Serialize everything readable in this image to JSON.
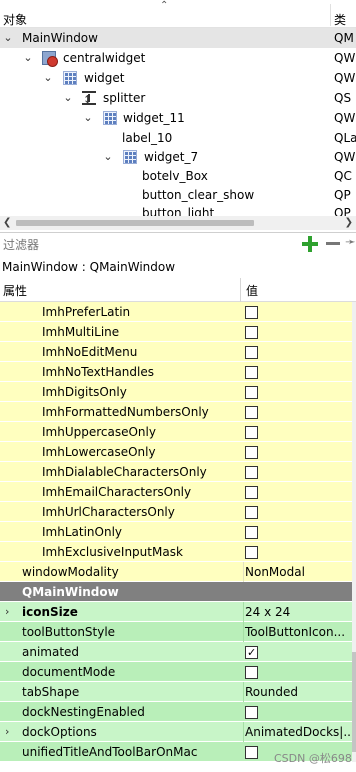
{
  "object_tree": {
    "col_object": "对象",
    "col_class": "类",
    "rows": [
      {
        "name": "MainWindow",
        "class": "QM"
      },
      {
        "name": "centralwidget",
        "class": "QW"
      },
      {
        "name": "widget",
        "class": "QW"
      },
      {
        "name": "splitter",
        "class": "QS"
      },
      {
        "name": "widget_11",
        "class": "QW"
      },
      {
        "name": "label_10",
        "class": "QLa"
      },
      {
        "name": "widget_7",
        "class": "QW"
      },
      {
        "name": "botelv_Box",
        "class": "QC"
      },
      {
        "name": "button_clear_show",
        "class": "QP"
      },
      {
        "name": "button_light",
        "class": "QP"
      }
    ]
  },
  "filter": {
    "placeholder": "过滤器"
  },
  "object_title": "MainWindow : QMainWindow",
  "properties": {
    "col_property": "属性",
    "col_value": "值",
    "input_hint_flags": [
      {
        "name": "ImhPreferLatin",
        "checked": false
      },
      {
        "name": "ImhMultiLine",
        "checked": false
      },
      {
        "name": "ImhNoEditMenu",
        "checked": false
      },
      {
        "name": "ImhNoTextHandles",
        "checked": false
      },
      {
        "name": "ImhDigitsOnly",
        "checked": false
      },
      {
        "name": "ImhFormattedNumbersOnly",
        "checked": false
      },
      {
        "name": "ImhUppercaseOnly",
        "checked": false
      },
      {
        "name": "ImhLowercaseOnly",
        "checked": false
      },
      {
        "name": "ImhDialableCharactersOnly",
        "checked": false
      },
      {
        "name": "ImhEmailCharactersOnly",
        "checked": false
      },
      {
        "name": "ImhUrlCharactersOnly",
        "checked": false
      },
      {
        "name": "ImhLatinOnly",
        "checked": false
      },
      {
        "name": "ImhExclusiveInputMask",
        "checked": false
      }
    ],
    "window_modality": {
      "name": "windowModality",
      "value": "NonModal"
    },
    "section": "QMainWindow",
    "main_window_props": [
      {
        "name": "iconSize",
        "value": "24 x 24",
        "bold": true,
        "expandable": true
      },
      {
        "name": "toolButtonStyle",
        "value": "ToolButtonIcon..."
      },
      {
        "name": "animated",
        "checked": true
      },
      {
        "name": "documentMode",
        "checked": false
      },
      {
        "name": "tabShape",
        "value": "Rounded"
      },
      {
        "name": "dockNestingEnabled",
        "checked": false
      },
      {
        "name": "dockOptions",
        "value": "AnimatedDocks|...",
        "expandable": true
      },
      {
        "name": "unifiedTitleAndToolBarOnMac",
        "checked": false
      }
    ]
  },
  "watermark": "CSDN @松698",
  "colors": {
    "row_yellow": "#ffffbf",
    "row_green": "#c8f5c8",
    "section_gray": "#808080",
    "plus_green": "#2fa12f"
  }
}
